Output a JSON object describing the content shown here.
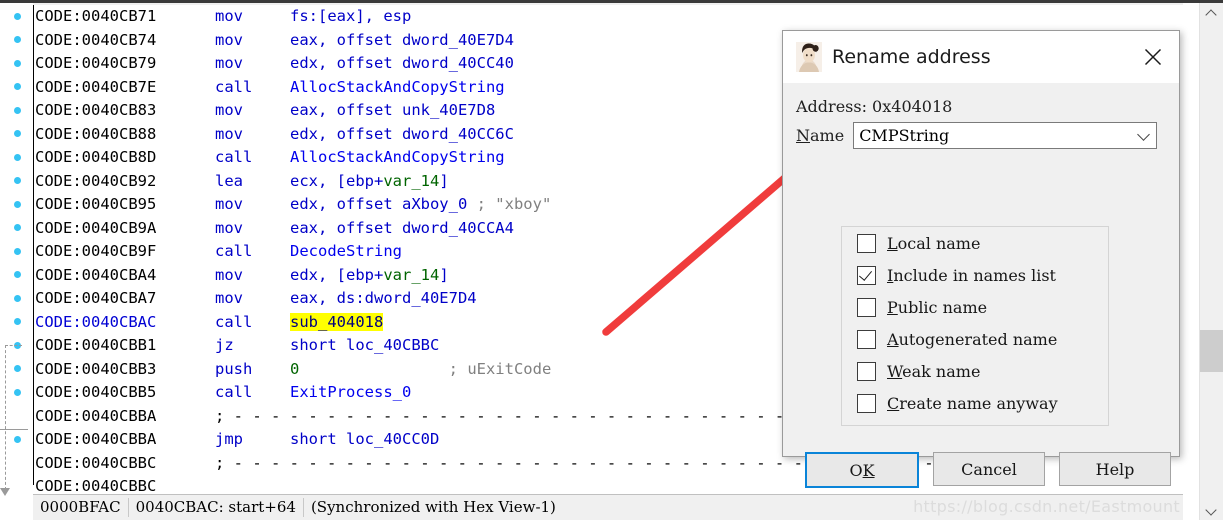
{
  "app": {
    "name": "IDA Pro disassembly view",
    "watermark": "https://blog.csdn.net/Eastmount"
  },
  "code_lines": [
    {
      "addr": "CODE:0040CB71",
      "current": false,
      "mnemonic": "mov",
      "operands": [
        {
          "t": "fs:[eax], esp",
          "c": "op"
        }
      ]
    },
    {
      "addr": "CODE:0040CB74",
      "current": false,
      "mnemonic": "mov",
      "operands": [
        {
          "t": "eax, offset dword_40E7D4",
          "c": "op"
        }
      ]
    },
    {
      "addr": "CODE:0040CB79",
      "current": false,
      "mnemonic": "mov",
      "operands": [
        {
          "t": "edx, offset dword_40CC40",
          "c": "op"
        }
      ]
    },
    {
      "addr": "CODE:0040CB7E",
      "current": false,
      "mnemonic": "call",
      "operands": [
        {
          "t": "AllocStackAndCopyString",
          "c": "fn"
        }
      ]
    },
    {
      "addr": "CODE:0040CB83",
      "current": false,
      "mnemonic": "mov",
      "operands": [
        {
          "t": "eax, offset unk_40E7D8",
          "c": "op"
        }
      ]
    },
    {
      "addr": "CODE:0040CB88",
      "current": false,
      "mnemonic": "mov",
      "operands": [
        {
          "t": "edx, offset dword_40CC6C",
          "c": "op"
        }
      ]
    },
    {
      "addr": "CODE:0040CB8D",
      "current": false,
      "mnemonic": "call",
      "operands": [
        {
          "t": "AllocStackAndCopyString",
          "c": "fn"
        }
      ]
    },
    {
      "addr": "CODE:0040CB92",
      "current": false,
      "mnemonic": "lea",
      "operands": [
        {
          "t": "ecx, [ebp+",
          "c": "op"
        },
        {
          "t": "var_14",
          "c": "var"
        },
        {
          "t": "]",
          "c": "op"
        }
      ]
    },
    {
      "addr": "CODE:0040CB95",
      "current": false,
      "mnemonic": "mov",
      "operands": [
        {
          "t": "edx, offset aXboy_0 ",
          "c": "op"
        },
        {
          "t": "; \"xboy\"",
          "c": "cmt"
        }
      ]
    },
    {
      "addr": "CODE:0040CB9A",
      "current": false,
      "mnemonic": "mov",
      "operands": [
        {
          "t": "eax, offset dword_40CCA4",
          "c": "op"
        }
      ]
    },
    {
      "addr": "CODE:0040CB9F",
      "current": false,
      "mnemonic": "call",
      "operands": [
        {
          "t": "DecodeString",
          "c": "fn"
        }
      ]
    },
    {
      "addr": "CODE:0040CBA4",
      "current": false,
      "mnemonic": "mov",
      "operands": [
        {
          "t": "edx, [ebp+",
          "c": "op"
        },
        {
          "t": "var_14",
          "c": "var"
        },
        {
          "t": "]",
          "c": "op"
        }
      ]
    },
    {
      "addr": "CODE:0040CBA7",
      "current": false,
      "mnemonic": "mov",
      "operands": [
        {
          "t": "eax, ds:dword_40E7D4",
          "c": "op"
        }
      ]
    },
    {
      "addr": "CODE:0040CBAC",
      "current": true,
      "mnemonic": "call",
      "operands": [
        {
          "t": "sub_404018",
          "c": "hl"
        }
      ]
    },
    {
      "addr": "CODE:0040CBB1",
      "current": false,
      "mnemonic": "jz",
      "operands": [
        {
          "t": "short loc_40CBBC",
          "c": "op"
        }
      ]
    },
    {
      "addr": "CODE:0040CBB3",
      "current": false,
      "mnemonic": "push",
      "operands": [
        {
          "t": "0",
          "c": "num"
        },
        {
          "t": "                ; uExitCode",
          "c": "cmt"
        }
      ]
    },
    {
      "addr": "CODE:0040CBB5",
      "current": false,
      "mnemonic": "call",
      "operands": [
        {
          "t": "ExitProcess_0",
          "c": "fn"
        }
      ]
    },
    {
      "addr": "CODE:0040CBBA",
      "current": false,
      "mnemonic": "",
      "operands": [
        {
          "t": "; - - - - - - - - - - - - - - - - - - - - - - - - - - - - - - - - - - - - - -",
          "c": "dash"
        }
      ],
      "separator": true
    },
    {
      "addr": "CODE:0040CBBA",
      "current": false,
      "mnemonic": "jmp",
      "operands": [
        {
          "t": "short loc_40CC0D",
          "c": "op"
        }
      ]
    },
    {
      "addr": "CODE:0040CBBC",
      "current": false,
      "mnemonic": "",
      "operands": [
        {
          "t": "; - - - - - - - - - - - - - - - - - - - - - - - - - - - - - - - - - - - - - -",
          "c": "dash"
        }
      ],
      "separator": true
    },
    {
      "addr": "CODE:0040CBBC",
      "current": false,
      "mnemonic": "",
      "operands": []
    }
  ],
  "status_bar": {
    "cells": [
      "0000BFAC",
      "0040CBAC: start+64",
      "(Synchronized with Hex View-1)"
    ]
  },
  "dialog": {
    "title": "Rename address",
    "icon": "ida-woman-icon",
    "close_label": "×",
    "address_label": "Address: 0x404018",
    "name_label_prefix": "N",
    "name_label_rest": "ame",
    "name_value": "CMPString",
    "name_placeholder": "",
    "checkboxes": [
      {
        "accel": "L",
        "rest": "ocal name",
        "checked": false
      },
      {
        "accel": "I",
        "rest": "nclude in names list",
        "checked": true
      },
      {
        "accel": "P",
        "rest": "ublic name",
        "checked": false
      },
      {
        "accel": "A",
        "rest": "utogenerated name",
        "checked": false
      },
      {
        "accel": "W",
        "rest": "eak name",
        "checked": false
      },
      {
        "accel": "C",
        "rest": "reate name anyway",
        "checked": false
      }
    ],
    "buttons": [
      {
        "pre": "O",
        "accel": "K",
        "post": "",
        "default": true
      },
      {
        "pre": "Cancel",
        "accel": "",
        "post": "",
        "default": false
      },
      {
        "pre": "Help",
        "accel": "",
        "post": "",
        "default": false
      }
    ]
  },
  "colors": {
    "highlight": "#ffff00",
    "code_blue": "#0000c8",
    "func_blue": "#0000ee",
    "var_green": "#006400",
    "comment_gray": "#808080",
    "accent_blue": "#0a84d8",
    "arrow_red": "#f03c3c",
    "dot_cyan": "#35c3f3"
  }
}
